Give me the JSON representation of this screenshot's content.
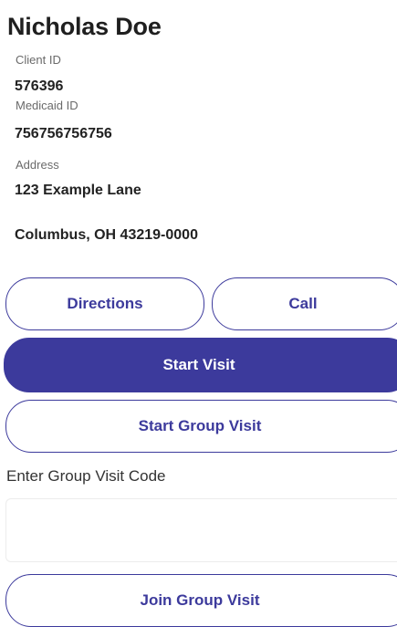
{
  "client": {
    "name": "Nicholas Doe",
    "client_id_label": "Client ID",
    "client_id": "576396",
    "medicaid_id_label": "Medicaid ID",
    "medicaid_id": "756756756756",
    "address_label": "Address",
    "address_line1": "123 Example Lane",
    "address_line2": "Columbus, OH 43219-0000"
  },
  "actions": {
    "directions_label": "Directions",
    "call_label": "Call",
    "start_visit_label": "Start Visit",
    "start_group_visit_label": "Start Group Visit"
  },
  "group_visit": {
    "code_label": "Enter Group Visit Code",
    "code_value": "",
    "join_label": "Join Group Visit"
  },
  "colors": {
    "accent": "#3c3a9c",
    "text": "#1f1f1f",
    "muted_label": "#6a6a6a"
  }
}
